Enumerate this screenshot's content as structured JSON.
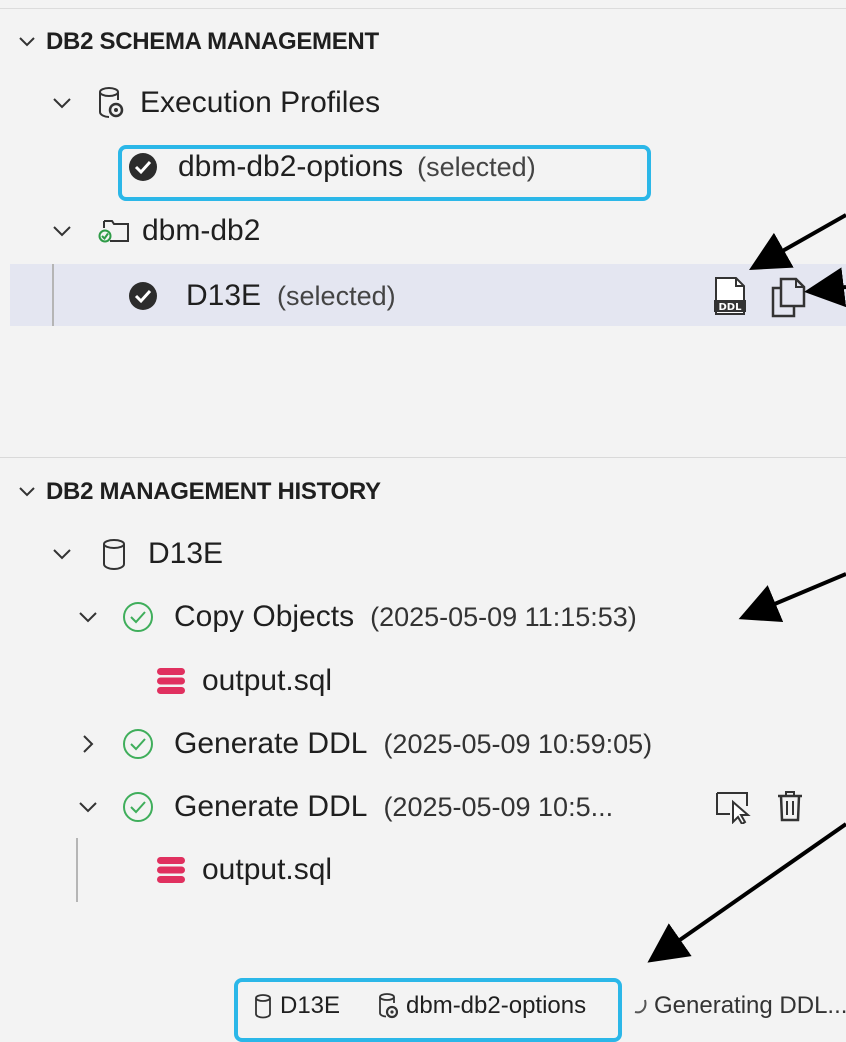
{
  "schema_section": {
    "title": "DB2 SCHEMA MANAGEMENT",
    "execution_profiles_label": "Execution Profiles",
    "profile_name": "dbm-db2-options",
    "profile_suffix": "(selected)",
    "connection_name": "dbm-db2",
    "schema_name": "D13E",
    "schema_suffix": "(selected)",
    "actions": [
      "ddl-generate-icon",
      "copy-icon"
    ]
  },
  "history_section": {
    "title": "DB2 MANAGEMENT HISTORY",
    "schema_name": "D13E",
    "entries": [
      {
        "label": "Copy Objects",
        "time": "(2025-05-09 11:15:53)",
        "expanded": true,
        "file": "output.sql"
      },
      {
        "label": "Generate DDL",
        "time": "(2025-05-09 10:59:05)",
        "expanded": false
      },
      {
        "label": "Generate DDL",
        "time": "(2025-05-09 10:5...",
        "expanded": true,
        "file": "output.sql"
      }
    ]
  },
  "status_bar": {
    "schema": "D13E",
    "profile": "dbm-db2-options",
    "progress": "Generating DDL..."
  },
  "colors": {
    "accent_outline": "#2bb7e8",
    "success_green": "#3fae5b",
    "sql_file_red": "#e0305f",
    "selection_bg": "#e4e6f1"
  }
}
